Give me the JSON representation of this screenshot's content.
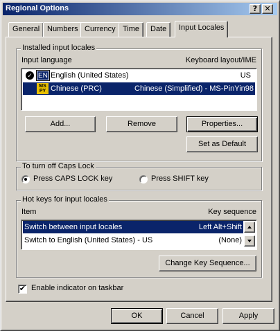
{
  "window": {
    "title": "Regional Options",
    "help_label": "?",
    "close_label": "✕"
  },
  "tabs": [
    {
      "label": "General"
    },
    {
      "label": "Numbers"
    },
    {
      "label": "Currency"
    },
    {
      "label": "Time"
    },
    {
      "label": "Date"
    },
    {
      "label": "Input Locales",
      "active": true
    }
  ],
  "installed": {
    "group_label": "Installed input locales",
    "col_language": "Input language",
    "col_layout": "Keyboard layout/IME",
    "items": [
      {
        "badge": "EN",
        "language": "English (United States)",
        "layout": "US",
        "default": true,
        "selected": false
      },
      {
        "badge": "MS PY",
        "language": "Chinese (PRC)",
        "layout": "Chinese (Simplified) - MS-PinYin98",
        "default": false,
        "selected": true
      }
    ],
    "add_label": "Add...",
    "remove_label": "Remove",
    "properties_label": "Properties...",
    "set_default_label": "Set as Default"
  },
  "caps": {
    "group_label": "To turn off Caps Lock",
    "option1": "Press CAPS LOCK key",
    "option2": "Press SHIFT key",
    "selected": "option1"
  },
  "hotkeys": {
    "group_label": "Hot keys for input locales",
    "col_item": "Item",
    "col_key": "Key sequence",
    "rows": [
      {
        "item": "Switch between input locales",
        "key": "Left Alt+Shift",
        "selected": true
      },
      {
        "item": "Switch to English (United States) - US",
        "key": "(None)",
        "selected": false
      }
    ],
    "change_label": "Change Key Sequence..."
  },
  "indicator": {
    "label": "Enable indicator on taskbar",
    "checked": true,
    "check_glyph": "✔"
  },
  "footer": {
    "ok_label": "OK",
    "cancel_label": "Cancel",
    "apply_label": "Apply"
  },
  "colors": {
    "selection": "#0a246a",
    "face": "#d4d0c8",
    "title_start": "#0a246a",
    "title_end": "#a6caf0"
  }
}
